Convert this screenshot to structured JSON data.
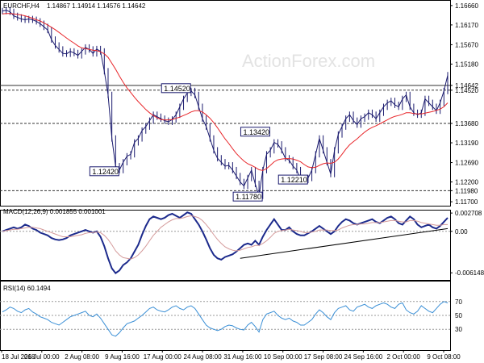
{
  "chart_data": [
    {
      "type": "candlestick",
      "title": "EURCHF,H4",
      "ohlc_readout": [
        "1.14867",
        "1.14914",
        "1.14576",
        "1.14642"
      ],
      "watermark": "ActionForex.com",
      "ylim": [
        1.116,
        1.168
      ],
      "y_ticks": [
        "1.16660",
        "1.16170",
        "1.15670",
        "1.15180",
        "1.14642",
        "1.14520",
        "1.13680",
        "1.13190",
        "1.12690",
        "1.12200",
        "1.11980",
        "1.11700"
      ],
      "levels": [
        {
          "value": 1.1452,
          "label": "1.14520",
          "line": "dashed"
        },
        {
          "value": 1.1368,
          "label": "1.13680",
          "line": "dashed"
        },
        {
          "value": 1.1198,
          "label": "1.11980",
          "line": "dashed"
        },
        {
          "value": 1.14642,
          "label": "1.14642",
          "line": "solid"
        }
      ],
      "annotations": [
        {
          "label": "1.14520",
          "x": 49,
          "value": 1.1452
        },
        {
          "label": "1.12420",
          "x": 30,
          "value": 1.1242
        },
        {
          "label": "1.13420",
          "x": 70,
          "value": 1.1342
        },
        {
          "label": "1.11780",
          "x": 68,
          "value": 1.1178
        },
        {
          "label": "1.12210",
          "x": 80,
          "value": 1.1221
        }
      ],
      "close_series": [
        1.1652,
        1.1654,
        1.165,
        1.164,
        1.1636,
        1.1632,
        1.163,
        1.1632,
        1.163,
        1.1626,
        1.162,
        1.1612,
        1.1604,
        1.158,
        1.1565,
        1.1555,
        1.1545,
        1.1544,
        1.155,
        1.1546,
        1.154,
        1.155,
        1.156,
        1.1555,
        1.1545,
        1.1556,
        1.155,
        1.15,
        1.144,
        1.133,
        1.126,
        1.125,
        1.127,
        1.1285,
        1.129,
        1.132,
        1.133,
        1.135,
        1.136,
        1.1375,
        1.139,
        1.1385,
        1.138,
        1.1375,
        1.1372,
        1.1378,
        1.139,
        1.141,
        1.143,
        1.1445,
        1.145,
        1.144,
        1.141,
        1.138,
        1.136,
        1.133,
        1.13,
        1.128,
        1.127,
        1.126,
        1.1262,
        1.125,
        1.1235,
        1.122,
        1.121,
        1.123,
        1.125,
        1.1215,
        1.1185,
        1.125,
        1.129,
        1.13,
        1.132,
        1.1315,
        1.13,
        1.128,
        1.1275,
        1.126,
        1.125,
        1.1225,
        1.1225,
        1.123,
        1.125,
        1.129,
        1.133,
        1.13,
        1.127,
        1.124,
        1.13,
        1.134,
        1.136,
        1.138,
        1.139,
        1.1375,
        1.1365,
        1.138,
        1.1385,
        1.1395,
        1.139,
        1.138,
        1.1395,
        1.141,
        1.142,
        1.1425,
        1.1415,
        1.141,
        1.143,
        1.144,
        1.141,
        1.1395,
        1.139,
        1.1395,
        1.143,
        1.142,
        1.141,
        1.14,
        1.142,
        1.145,
        1.149
      ],
      "ma_series": [
        1.1645,
        1.1646,
        1.1646,
        1.1645,
        1.1644,
        1.1642,
        1.164,
        1.1637,
        1.1634,
        1.163,
        1.1627,
        1.1622,
        1.1617,
        1.1611,
        1.1605,
        1.1598,
        1.1591,
        1.1584,
        1.1577,
        1.1571,
        1.1564,
        1.1559,
        1.1557,
        1.1555,
        1.1553,
        1.1552,
        1.1549,
        1.1544,
        1.1535,
        1.152,
        1.1505,
        1.1488,
        1.1472,
        1.1458,
        1.1446,
        1.1434,
        1.1423,
        1.1413,
        1.1403,
        1.1395,
        1.1388,
        1.1382,
        1.1378,
        1.1377,
        1.1377,
        1.1378,
        1.1381,
        1.1384,
        1.1388,
        1.1392,
        1.1397,
        1.14,
        1.14,
        1.1397,
        1.139,
        1.1381,
        1.137,
        1.1357,
        1.1343,
        1.1329,
        1.1317,
        1.1304,
        1.1292,
        1.1282,
        1.1273,
        1.1266,
        1.1262,
        1.1257,
        1.1251,
        1.1249,
        1.1254,
        1.1262,
        1.1271,
        1.1276,
        1.1278,
        1.1279,
        1.1279,
        1.1278,
        1.1275,
        1.1271,
        1.1264,
        1.1258,
        1.1256,
        1.1257,
        1.1262,
        1.1266,
        1.1268,
        1.1267,
        1.127,
        1.1278,
        1.129,
        1.1303,
        1.1314,
        1.1322,
        1.1329,
        1.1338,
        1.1346,
        1.1353,
        1.1358,
        1.1362,
        1.1367,
        1.1372,
        1.1377,
        1.1382,
        1.1386,
        1.1388,
        1.1391,
        1.1395,
        1.1395,
        1.1393,
        1.1392,
        1.1392,
        1.1394,
        1.1396,
        1.1398,
        1.1401,
        1.1404,
        1.141,
        1.142
      ]
    },
    {
      "type": "line",
      "title": "MACD(12,26,9) 0.001855 0.001001",
      "ylim": [
        -0.0072,
        0.0032
      ],
      "y_ticks": [
        "0.002708",
        "0.00",
        "-0.006148"
      ],
      "series": [
        {
          "values": [
            0.0,
            0.0002,
            0.0004,
            0.0006,
            0.0004,
            0.0006,
            0.001,
            0.0008,
            0.0004,
            0.0002,
            -0.0002,
            -0.0004,
            -0.0006,
            -0.001,
            -0.0012,
            -0.0013,
            -0.0012,
            -0.001,
            -0.0006,
            -0.0004,
            -0.0002,
            0.0,
            0.0002,
            0.0,
            -0.0002,
            0.0,
            -0.0008,
            -0.0022,
            -0.004,
            -0.0055,
            -0.0062,
            -0.0058,
            -0.005,
            -0.0046,
            -0.004,
            -0.003,
            -0.002,
            -0.0005,
            0.0008,
            0.0018,
            0.0022,
            0.002,
            0.0018,
            0.002,
            0.0024,
            0.0026,
            0.0023,
            0.002,
            0.0024,
            0.0028,
            0.0026,
            0.0018,
            0.001,
            0.0,
            -0.0012,
            -0.0025,
            -0.0035,
            -0.004,
            -0.0042,
            -0.0038,
            -0.0036,
            -0.0034,
            -0.003,
            -0.0025,
            -0.002,
            -0.0018,
            -0.002,
            -0.0014,
            -0.002,
            -0.0008,
            0.0002,
            0.001,
            0.0018,
            0.001,
            0.0002,
            0.0002,
            0.0006,
            0.0,
            -0.0004,
            -0.0006,
            -0.0006,
            -0.0003,
            0.0,
            0.0004,
            0.0008,
            0.0004,
            0.0,
            -0.0004,
            0.0,
            0.0008,
            0.0014,
            0.0018,
            0.0016,
            0.0012,
            0.001,
            0.0012,
            0.0014,
            0.0016,
            0.0018,
            0.0014,
            0.0012,
            0.0016,
            0.002,
            0.0022,
            0.0018,
            0.0012,
            0.001,
            0.0016,
            0.0022,
            0.0018,
            0.001,
            0.0006,
            0.0008,
            0.001,
            0.0006,
            0.0004,
            0.0008,
            0.0014,
            0.002
          ]
        },
        {
          "values": [
            0.0,
            0.0001,
            0.0002,
            0.0003,
            0.0003,
            0.0004,
            0.0005,
            0.0006,
            0.0006,
            0.0005,
            0.0004,
            0.0002,
            0.0,
            -0.0002,
            -0.0004,
            -0.0006,
            -0.0008,
            -0.0008,
            -0.0008,
            -0.0007,
            -0.0006,
            -0.0005,
            -0.0003,
            -0.0002,
            -0.0002,
            -0.0001,
            -0.0002,
            -0.0006,
            -0.0012,
            -0.002,
            -0.0029,
            -0.0035,
            -0.0039,
            -0.004,
            -0.0041,
            -0.0039,
            -0.0035,
            -0.0029,
            -0.0022,
            -0.0014,
            -0.0006,
            0.0,
            0.0006,
            0.001,
            0.0014,
            0.0017,
            0.0019,
            0.0019,
            0.002,
            0.0022,
            0.0023,
            0.0022,
            0.002,
            0.0016,
            0.001,
            0.0003,
            -0.0005,
            -0.0012,
            -0.0018,
            -0.0023,
            -0.0026,
            -0.0028,
            -0.0029,
            -0.0028,
            -0.0026,
            -0.0024,
            -0.0023,
            -0.0021,
            -0.0021,
            -0.0018,
            -0.0014,
            -0.0009,
            -0.0003,
            0.0,
            0.0001,
            0.0002,
            0.0003,
            0.0002,
            0.0001,
            0.0,
            -0.0002,
            -0.0002,
            -0.0001,
            0.0,
            0.0002,
            0.0002,
            0.0002,
            0.0001,
            0.0001,
            0.0002,
            0.0005,
            0.0007,
            0.0009,
            0.001,
            0.001,
            0.0011,
            0.0011,
            0.0012,
            0.0013,
            0.0013,
            0.0013,
            0.0014,
            0.0015,
            0.0016,
            0.0016,
            0.0015,
            0.0014,
            0.0014,
            0.0016,
            0.0016,
            0.0015,
            0.0013,
            0.0012,
            0.0011,
            0.001,
            0.0009,
            0.0009,
            0.001,
            0.001
          ]
        }
      ],
      "trendline": [
        {
          "i": 63,
          "value": -0.004
        },
        {
          "i": 118,
          "value": 0.0004
        }
      ]
    },
    {
      "type": "line",
      "title": "RSI(14) 60.1494",
      "ylim": [
        0,
        100
      ],
      "y_ticks": [
        "70",
        "50",
        "30"
      ],
      "series": [
        {
          "values": [
            55,
            58,
            62,
            60,
            56,
            54,
            58,
            60,
            55,
            52,
            48,
            46,
            44,
            40,
            38,
            36,
            40,
            44,
            48,
            50,
            52,
            54,
            56,
            50,
            48,
            52,
            46,
            38,
            30,
            22,
            20,
            25,
            32,
            38,
            40,
            42,
            46,
            50,
            55,
            60,
            62,
            58,
            56,
            55,
            58,
            62,
            64,
            60,
            58,
            62,
            64,
            60,
            52,
            44,
            36,
            32,
            30,
            28,
            30,
            34,
            36,
            35,
            32,
            30,
            29,
            36,
            40,
            34,
            26,
            44,
            52,
            54,
            56,
            50,
            46,
            44,
            46,
            42,
            40,
            36,
            36,
            40,
            44,
            52,
            58,
            54,
            48,
            44,
            54,
            60,
            62,
            64,
            58,
            56,
            62,
            64,
            66,
            62,
            60,
            64,
            66,
            68,
            66,
            62,
            60,
            66,
            68,
            58,
            54,
            52,
            56,
            64,
            60,
            56,
            54,
            60,
            66,
            70,
            68
          ]
        }
      ]
    }
  ],
  "x_ticks": [
    "18 Jul 2018",
    "26 Jul 00:00",
    "2 Aug 08:00",
    "9 Aug 16:00",
    "17 Aug 00:00",
    "24 Aug 08:00",
    "31 Aug 16:00",
    "10 Sep 00:00",
    "17 Sep 08:00",
    "24 Sep 16:00",
    "2 Oct 00:00",
    "9 Oct 08:00"
  ],
  "colors": {
    "candle": "#1a1a6e",
    "ma": "#e8262a",
    "macd": "#1c2a8c",
    "signal": "#d49a9a",
    "rsi": "#3a8fd6",
    "level": "#333333",
    "grid": "#9a9a9a",
    "watermark": "#e3e3e3"
  }
}
